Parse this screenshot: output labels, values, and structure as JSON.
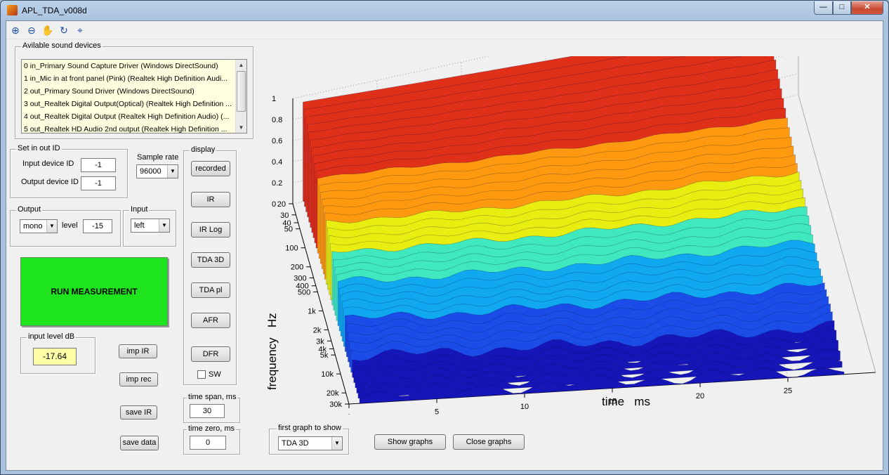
{
  "window": {
    "title": "APL_TDA_v008d",
    "min_label": "—",
    "max_label": "□",
    "close_label": "✕"
  },
  "toolbar": {
    "tools": [
      {
        "name": "zoom-in-icon",
        "glyph": "⊕"
      },
      {
        "name": "zoom-out-icon",
        "glyph": "⊖"
      },
      {
        "name": "pan-hand-icon",
        "glyph": "✋"
      },
      {
        "name": "rotate-3d-icon",
        "glyph": "↻"
      },
      {
        "name": "data-cursor-icon",
        "glyph": "⌖"
      }
    ]
  },
  "devices": {
    "title": "Avilable sound devices",
    "items": [
      "0 in_Primary Sound Capture Driver (Windows DirectSound)",
      "1 in_Mic in at front panel (Pink) (Realtek High Definition Audi...",
      "2 out_Primary Sound Driver (Windows DirectSound)",
      "3 out_Realtek Digital Output(Optical) (Realtek High Definition ...",
      "4 out_Realtek Digital Output (Realtek High Definition Audio) (...",
      "5 out_Realtek HD Audio 2nd output (Realtek High Definition ..."
    ]
  },
  "inout": {
    "title": "Set in out ID",
    "input_label": "Input device ID",
    "input_value": "-1",
    "output_label": "Output device ID",
    "output_value": "-1"
  },
  "sample_rate": {
    "label": "Sample rate",
    "value": "96000"
  },
  "output": {
    "title": "Output",
    "mode": "mono",
    "level_label": "level",
    "level_value": "-15"
  },
  "input": {
    "title": "Input",
    "channel": "left"
  },
  "run_label": "RUN MEASUREMENT",
  "input_level": {
    "title": "input level dB",
    "value": "-17.64"
  },
  "buttons": {
    "imp_ir": "imp IR",
    "imp_rec": "imp rec",
    "save_ir": "save IR",
    "save_data": "save data",
    "show_graphs": "Show graphs",
    "close_graphs": "Close graphs"
  },
  "display": {
    "title": "display",
    "buttons": [
      "recorded",
      "IR",
      "IR Log",
      "TDA 3D",
      "TDA pl",
      "AFR",
      "DFR"
    ],
    "sw_label": "SW"
  },
  "time_span": {
    "title": "time span, ms",
    "value": "30"
  },
  "time_zero": {
    "title": "time zero, ms",
    "value": "0"
  },
  "first_graph": {
    "title": "first graph to show",
    "value": "TDA 3D"
  },
  "chart_data": {
    "type": "surface3d",
    "title": "",
    "xlabel": "time   ms",
    "ylabel": "frequency   Hz",
    "zlabel": "",
    "x_ticks": [
      "0",
      "5",
      "10",
      "15",
      "20",
      "25"
    ],
    "y_ticks": [
      "20",
      "30",
      "40",
      "50",
      "100",
      "200",
      "300",
      "400",
      "500",
      "1k",
      "2k",
      "3k",
      "4k",
      "5k",
      "10k",
      "20k",
      "30k"
    ],
    "z_ticks": [
      "0",
      "0.2",
      "0.4",
      "0.6",
      "0.8",
      "1"
    ],
    "xlim": [
      0,
      30
    ],
    "ylim": [
      20,
      30000
    ],
    "zlim": [
      0,
      1
    ],
    "y_scale": "log",
    "grid": true,
    "colormap": "jet"
  }
}
